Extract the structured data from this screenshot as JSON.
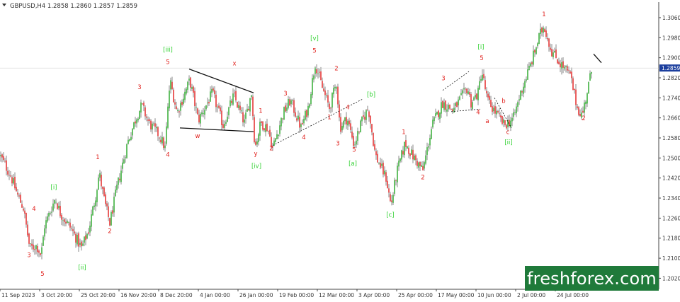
{
  "header": {
    "symbol_line": "GBPUSD,H4 1.2858 1.2860 1.2857 1.2859"
  },
  "watermark": {
    "text": "freshforex.com"
  },
  "colors": {
    "bull": "#23a623",
    "bear": "#e11b1b",
    "wick": "#3a3a3a",
    "green_label": "#2fd12f",
    "red_label": "#e0201c",
    "price_tag_bg": "#1c3f9e",
    "axis_text": "#333333",
    "watermark_bg": "#1f7a3a"
  },
  "chart_data": {
    "type": "candlestick",
    "series_name": "GBPUSD,H4",
    "ohlc_last": {
      "open": 1.2858,
      "high": 1.286,
      "low": 1.2857,
      "close": 1.2859
    },
    "current_price": "1.2859",
    "ylim": [
      1.195,
      1.313
    ],
    "yticks": [
      "1.3060",
      "1.2980",
      "1.2900",
      "1.2820",
      "1.2740",
      "1.2660",
      "1.2580",
      "1.2500",
      "1.2420",
      "1.2340",
      "1.2260",
      "1.2180",
      "1.2100",
      "1.2020"
    ],
    "xtick_labels": [
      "11 Sep 2023",
      "3 Oct 20:00",
      "25 Oct 20:00",
      "16 Nov 20:00",
      "8 Dec 20:00",
      "4 Jan 00:00",
      "26 Jan 00:00",
      "19 Feb 00:00",
      "12 Mar 00:00",
      "3 Apr 00:00",
      "25 Apr 00:00",
      "17 May 00:00",
      "10 Jun 00:00",
      "2 Jul 00:00",
      "24 Jul 00:00"
    ],
    "xlim": [
      0,
      930
    ],
    "path_keypoints": [
      [
        0,
        1.251
      ],
      [
        15,
        1.243
      ],
      [
        25,
        1.235
      ],
      [
        33,
        1.23
      ],
      [
        42,
        1.214
      ],
      [
        52,
        1.215
      ],
      [
        58,
        1.211
      ],
      [
        63,
        1.223
      ],
      [
        70,
        1.228
      ],
      [
        78,
        1.234
      ],
      [
        85,
        1.228
      ],
      [
        100,
        1.222
      ],
      [
        115,
        1.214
      ],
      [
        125,
        1.221
      ],
      [
        135,
        1.235
      ],
      [
        140,
        1.244
      ],
      [
        148,
        1.232
      ],
      [
        155,
        1.224
      ],
      [
        165,
        1.238
      ],
      [
        180,
        1.256
      ],
      [
        192,
        1.266
      ],
      [
        200,
        1.271
      ],
      [
        210,
        1.264
      ],
      [
        225,
        1.259
      ],
      [
        233,
        1.254
      ],
      [
        240,
        1.281
      ],
      [
        250,
        1.268
      ],
      [
        268,
        1.281
      ],
      [
        280,
        1.265
      ],
      [
        300,
        1.276
      ],
      [
        315,
        1.263
      ],
      [
        330,
        1.275
      ],
      [
        345,
        1.264
      ],
      [
        355,
        1.276
      ],
      [
        360,
        1.254
      ],
      [
        368,
        1.264
      ],
      [
        378,
        1.262
      ],
      [
        385,
        1.254
      ],
      [
        400,
        1.268
      ],
      [
        410,
        1.273
      ],
      [
        425,
        1.262
      ],
      [
        435,
        1.27
      ],
      [
        445,
        1.288
      ],
      [
        455,
        1.278
      ],
      [
        465,
        1.27
      ],
      [
        475,
        1.28
      ],
      [
        480,
        1.262
      ],
      [
        490,
        1.266
      ],
      [
        500,
        1.255
      ],
      [
        510,
        1.264
      ],
      [
        520,
        1.27
      ],
      [
        530,
        1.251
      ],
      [
        545,
        1.242
      ],
      [
        552,
        1.231
      ],
      [
        560,
        1.244
      ],
      [
        572,
        1.256
      ],
      [
        582,
        1.251
      ],
      [
        597,
        1.245
      ],
      [
        610,
        1.263
      ],
      [
        625,
        1.272
      ],
      [
        640,
        1.269
      ],
      [
        660,
        1.278
      ],
      [
        665,
        1.272
      ],
      [
        675,
        1.276
      ],
      [
        680,
        1.285
      ],
      [
        688,
        1.273
      ],
      [
        700,
        1.268
      ],
      [
        712,
        1.263
      ],
      [
        725,
        1.266
      ],
      [
        735,
        1.276
      ],
      [
        750,
        1.288
      ],
      [
        762,
        1.299
      ],
      [
        768,
        1.303
      ],
      [
        778,
        1.293
      ],
      [
        790,
        1.288
      ],
      [
        805,
        1.283
      ],
      [
        815,
        1.27
      ],
      [
        822,
        1.267
      ],
      [
        830,
        1.278
      ],
      [
        836,
        1.2859
      ]
    ],
    "annotations": [
      {
        "text": "5",
        "x": 60,
        "y": 1.203,
        "color": "red"
      },
      {
        "text": "3",
        "x": 41,
        "y": 1.2105,
        "color": "red"
      },
      {
        "text": "4",
        "x": 48,
        "y": 1.229,
        "color": "red"
      },
      {
        "text": "[i]",
        "x": 76,
        "y": 1.2375,
        "color": "green"
      },
      {
        "text": "[ii]",
        "x": 116,
        "y": 1.2055,
        "color": "green"
      },
      {
        "text": "1",
        "x": 138,
        "y": 1.2495,
        "color": "red"
      },
      {
        "text": "2",
        "x": 155,
        "y": 1.22,
        "color": "red"
      },
      {
        "text": "3",
        "x": 197,
        "y": 1.2775,
        "color": "red"
      },
      {
        "text": "4",
        "x": 237,
        "y": 1.2505,
        "color": "red"
      },
      {
        "text": "5",
        "x": 237,
        "y": 1.2875,
        "color": "red"
      },
      {
        "text": "[iii]",
        "x": 237,
        "y": 1.2925,
        "color": "green"
      },
      {
        "text": "x",
        "x": 331,
        "y": 1.287,
        "color": "red"
      },
      {
        "text": "w",
        "x": 279,
        "y": 1.258,
        "color": "red"
      },
      {
        "text": "y",
        "x": 361,
        "y": 1.251,
        "color": "red"
      },
      {
        "text": "[iv]",
        "x": 362,
        "y": 1.246,
        "color": "green"
      },
      {
        "text": "1",
        "x": 368,
        "y": 1.268,
        "color": "red"
      },
      {
        "text": "2",
        "x": 383,
        "y": 1.253,
        "color": "red"
      },
      {
        "text": "3",
        "x": 403,
        "y": 1.275,
        "color": "red"
      },
      {
        "text": "4",
        "x": 429,
        "y": 1.2575,
        "color": "red"
      },
      {
        "text": "5",
        "x": 444,
        "y": 1.292,
        "color": "red"
      },
      {
        "text": "[v]",
        "x": 444,
        "y": 1.297,
        "color": "green"
      },
      {
        "text": "1",
        "x": 465,
        "y": 1.2655,
        "color": "red"
      },
      {
        "text": "2",
        "x": 475,
        "y": 1.285,
        "color": "red"
      },
      {
        "text": "3",
        "x": 477,
        "y": 1.255,
        "color": "red"
      },
      {
        "text": "4",
        "x": 491,
        "y": 1.2695,
        "color": "red"
      },
      {
        "text": "5",
        "x": 500,
        "y": 1.2525,
        "color": "red"
      },
      {
        "text": "[a]",
        "x": 498,
        "y": 1.247,
        "color": "green"
      },
      {
        "text": "[b]",
        "x": 524,
        "y": 1.2745,
        "color": "green"
      },
      {
        "text": "[c]",
        "x": 551,
        "y": 1.2265,
        "color": "green"
      },
      {
        "text": "1",
        "x": 570,
        "y": 1.2595,
        "color": "red"
      },
      {
        "text": "2",
        "x": 597,
        "y": 1.2415,
        "color": "red"
      },
      {
        "text": "3",
        "x": 626,
        "y": 1.281,
        "color": "red"
      },
      {
        "text": "4",
        "x": 675,
        "y": 1.2675,
        "color": "red"
      },
      {
        "text": "5",
        "x": 680,
        "y": 1.289,
        "color": "red"
      },
      {
        "text": "[i]",
        "x": 679,
        "y": 1.2935,
        "color": "green"
      },
      {
        "text": "a",
        "x": 688,
        "y": 1.264,
        "color": "red"
      },
      {
        "text": "b",
        "x": 711,
        "y": 1.272,
        "color": "red"
      },
      {
        "text": "c",
        "x": 717,
        "y": 1.2595,
        "color": "red"
      },
      {
        "text": "[ii]",
        "x": 718,
        "y": 1.2555,
        "color": "green"
      },
      {
        "text": "1",
        "x": 768,
        "y": 1.3065,
        "color": "red"
      },
      {
        "text": "2",
        "x": 824,
        "y": 1.265,
        "color": "red"
      }
    ],
    "trendlines": [
      {
        "style": "solid",
        "points": [
          [
            267,
            1.2855
          ],
          [
            358,
            1.276
          ]
        ]
      },
      {
        "style": "solid",
        "points": [
          [
            254,
            1.262
          ],
          [
            358,
            1.2605
          ]
        ]
      },
      {
        "style": "dotted",
        "points": [
          [
            385,
            1.255
          ],
          [
            512,
            1.2735
          ]
        ]
      },
      {
        "style": "dotted",
        "points": [
          [
            625,
            1.277
          ],
          [
            662,
            1.2845
          ]
        ]
      },
      {
        "style": "dotted",
        "points": [
          [
            637,
            1.2685
          ],
          [
            678,
            1.2695
          ]
        ]
      },
      {
        "style": "dotted",
        "points": [
          [
            698,
            1.274
          ],
          [
            722,
            1.262
          ]
        ]
      },
      {
        "style": "solid",
        "points": [
          [
            838,
            1.2915
          ],
          [
            849,
            1.288
          ]
        ]
      }
    ]
  }
}
